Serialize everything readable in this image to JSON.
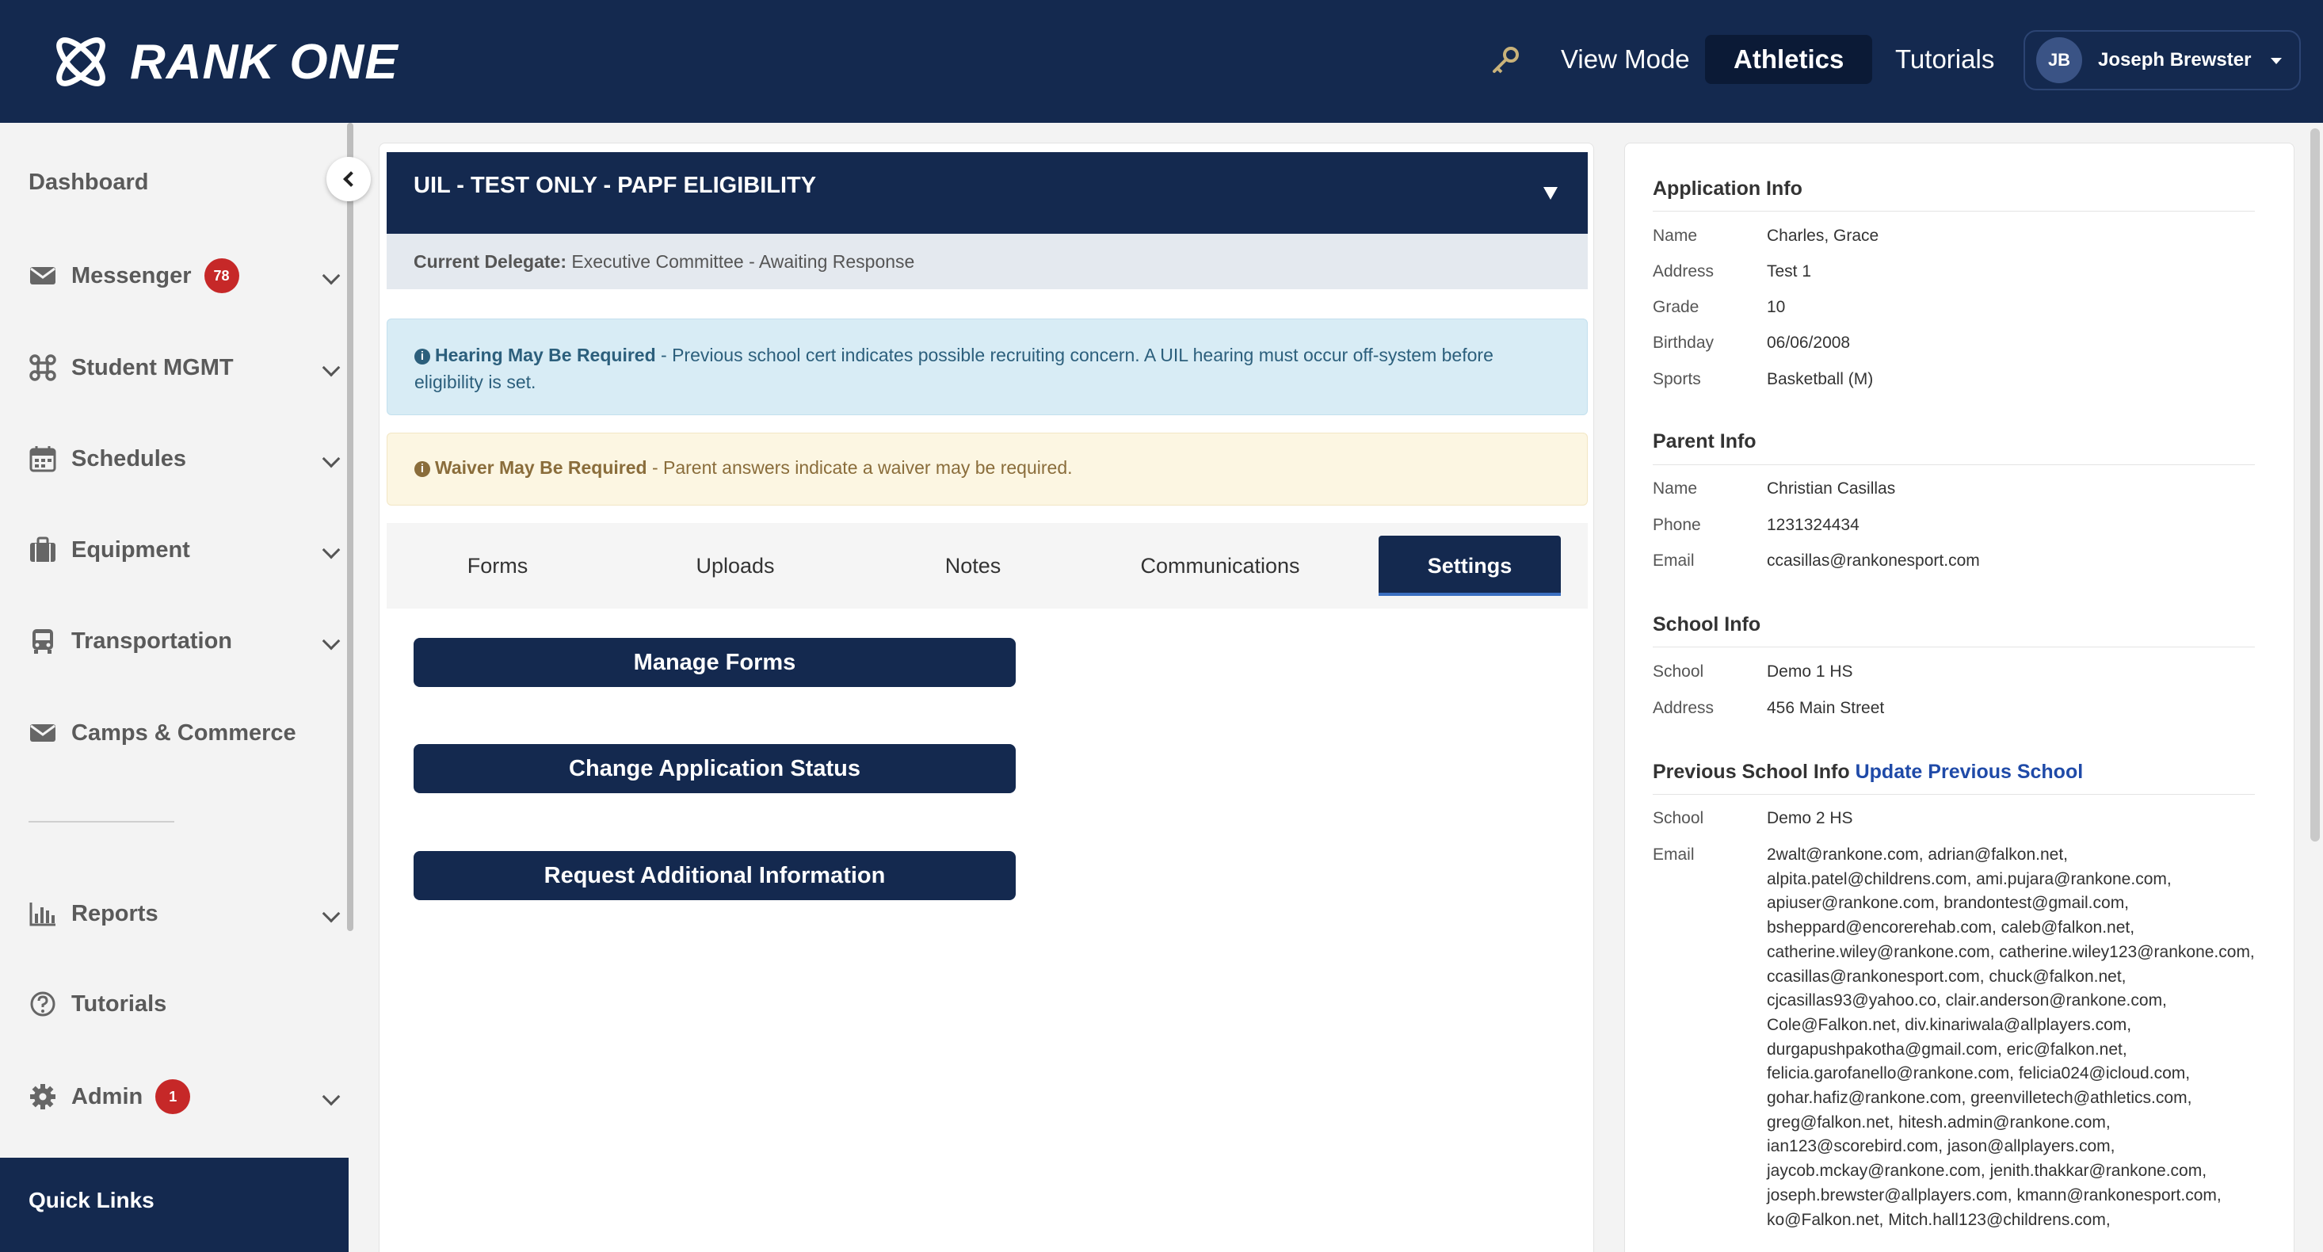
{
  "header": {
    "logo_text": "RANK ONE",
    "nav": [
      "View Mode",
      "Athletics",
      "Tutorials"
    ],
    "active_nav": "Athletics",
    "user": {
      "initials": "JB",
      "name": "Joseph Brewster"
    }
  },
  "sidebar": {
    "items": [
      {
        "label": "Dashboard",
        "icon": "dashboard",
        "badge": "",
        "chevron": false
      },
      {
        "label": "Messenger",
        "icon": "envelope-icon",
        "badge": "78",
        "chevron": true
      },
      {
        "label": "Student MGMT",
        "icon": "command-icon",
        "badge": "",
        "chevron": true
      },
      {
        "label": "Schedules",
        "icon": "calendar-icon",
        "badge": "",
        "chevron": true
      },
      {
        "label": "Equipment",
        "icon": "briefcase-icon",
        "badge": "",
        "chevron": true
      },
      {
        "label": "Transportation",
        "icon": "bus-icon",
        "badge": "",
        "chevron": true
      },
      {
        "label": "Camps & Commerce",
        "icon": "envelope-icon",
        "badge": "",
        "chevron": false
      },
      {
        "label": "Reports",
        "icon": "bar-chart-icon",
        "badge": "",
        "chevron": true
      },
      {
        "label": "Tutorials",
        "icon": "question-icon",
        "badge": "",
        "chevron": false
      },
      {
        "label": "Admin",
        "icon": "gear-icon",
        "badge": "1",
        "chevron": true
      }
    ],
    "quick_links": "Quick Links"
  },
  "application": {
    "title": "UIL - TEST ONLY - PAPF ELIGIBILITY",
    "delegate_label": "Current Delegate:",
    "delegate_value": "Executive Committee - Awaiting Response",
    "alert_info_title": "Hearing May Be Required",
    "alert_info_text": " - Previous school cert indicates possible recruiting concern. A UIL hearing must occur off-system before eligibility is set.",
    "alert_warn_title": "Waiver May Be Required",
    "alert_warn_text": " - Parent answers indicate a waiver may be required.",
    "tabs": [
      "Forms",
      "Uploads",
      "Notes",
      "Communications",
      "Settings"
    ],
    "active_tab": "Settings",
    "buttons": [
      "Manage Forms",
      "Change Application Status",
      "Request Additional Information"
    ]
  },
  "info": {
    "application": {
      "title": "Application Info",
      "rows": [
        {
          "key": "Name",
          "value": "Charles, Grace"
        },
        {
          "key": "Address",
          "value": "Test 1"
        },
        {
          "key": "Grade",
          "value": "10"
        },
        {
          "key": "Birthday",
          "value": "06/06/2008"
        },
        {
          "key": "Sports",
          "value": "Basketball (M)"
        }
      ]
    },
    "parent": {
      "title": "Parent Info",
      "rows": [
        {
          "key": "Name",
          "value": "Christian Casillas"
        },
        {
          "key": "Phone",
          "value": "1231324434"
        },
        {
          "key": "Email",
          "value": "ccasillas@rankonesport.com"
        }
      ]
    },
    "school": {
      "title": "School Info",
      "rows": [
        {
          "key": "School",
          "value": "Demo 1 HS"
        },
        {
          "key": "Address",
          "value": "456 Main Street"
        }
      ]
    },
    "previous_school": {
      "title": "Previous School Info",
      "link": "Update Previous School",
      "school_key": "School",
      "school_value": "Demo 2 HS",
      "email_key": "Email",
      "emails": "2walt@rankone.com, adrian@falkon.net, alpita.patel@childrens.com, ami.pujara@rankone.com, apiuser@rankone.com, brandontest@gmail.com, bsheppard@encorerehab.com, caleb@falkon.net, catherine.wiley@rankone.com, catherine.wiley123@rankone.com, ccasillas@rankonesport.com, chuck@falkon.net, cjcasillas93@yahoo.co, clair.anderson@rankone.com, Cole@Falkon.net, div.kinariwala@allplayers.com, durgapushpakotha@gmail.com, eric@falkon.net, felicia.garofanello@rankone.com, felicia024@icloud.com, gohar.hafiz@rankone.com, greenvilletech@athletics.com, greg@falkon.net, hitesh.admin@rankone.com, ian123@scorebird.com, jason@allplayers.com, jaycob.mckay@rankone.com, jenith.thakkar@rankone.com, joseph.brewster@allplayers.com, kmann@rankonesport.com, ko@Falkon.net, Mitch.hall123@childrens.com,"
    }
  }
}
